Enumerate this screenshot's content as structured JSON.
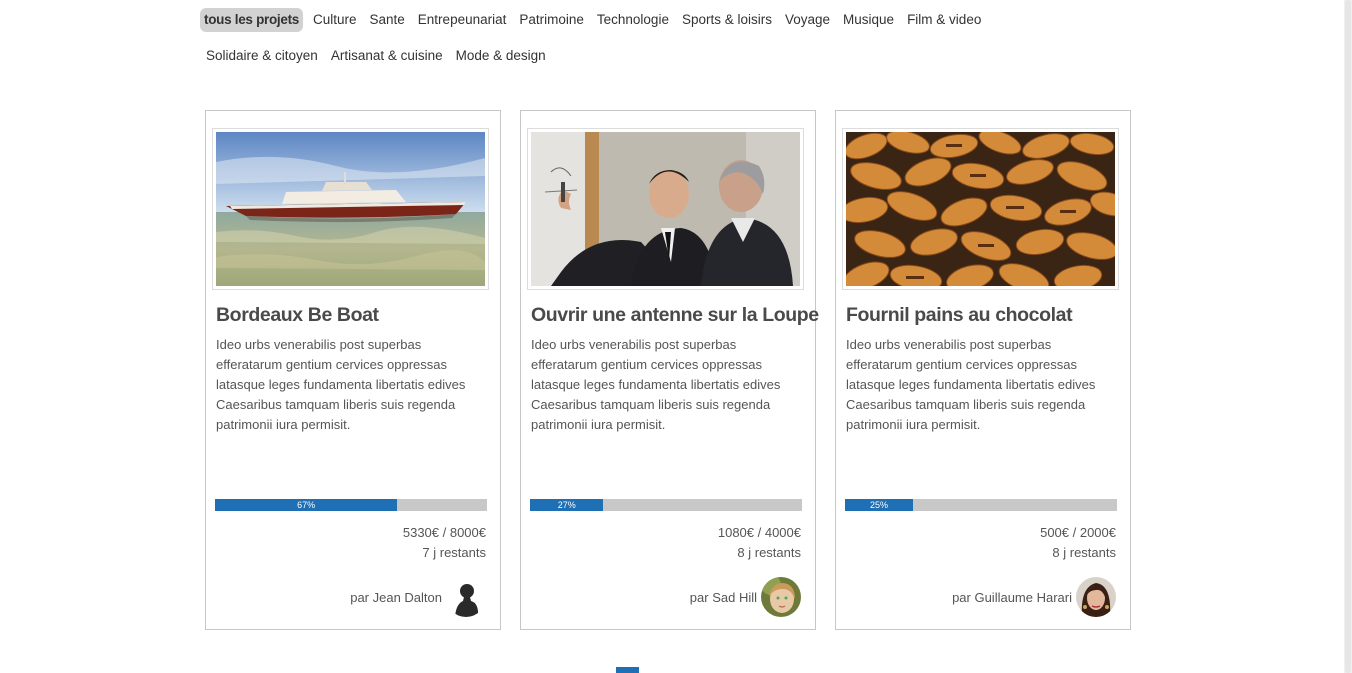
{
  "categories": [
    {
      "label": "tous les projets",
      "active": true
    },
    {
      "label": "Culture"
    },
    {
      "label": "Sante"
    },
    {
      "label": "Entrepeunariat"
    },
    {
      "label": "Patrimoine"
    },
    {
      "label": "Technologie"
    },
    {
      "label": "Sports & loisirs"
    },
    {
      "label": "Voyage"
    },
    {
      "label": "Musique"
    },
    {
      "label": "Film & video"
    },
    {
      "label": "Solidaire & citoyen"
    },
    {
      "label": "Artisanat & cuisine"
    },
    {
      "label": "Mode & design"
    }
  ],
  "projects": [
    {
      "image": "boat-photo",
      "title": "Bordeaux Be Boat",
      "description": "Ideo urbs venerabilis post superbas efferatarum gentium cervices oppressas latasque leges fundamenta libertatis edives Caesaribus tamquam liberis suis regenda patrimonii iura permisit.",
      "progress": 0.67,
      "progress_label": "67%",
      "amount": "5330€ / 8000€",
      "days_left": "7 j restants",
      "author": "par Jean Dalton",
      "avatar": "silhouette-avatar"
    },
    {
      "image": "meeting-photo",
      "title": "Ouvrir une antenne sur la Loupe",
      "description": "Ideo urbs venerabilis post superbas efferatarum gentium cervices oppressas latasque leges fundamenta libertatis edives Caesaribus tamquam liberis suis regenda patrimonii iura permisit.",
      "progress": 0.27,
      "progress_label": "27%",
      "amount": "1080€ / 4000€",
      "days_left": "8 j restants",
      "author": "par Sad Hill",
      "avatar": "child-avatar"
    },
    {
      "image": "pastries-photo",
      "title": "Fournil pains au chocolat",
      "description": "Ideo urbs venerabilis post superbas efferatarum gentium cervices oppressas latasque leges fundamenta libertatis edives Caesaribus tamquam liberis suis regenda patrimonii iura permisit.",
      "progress": 0.25,
      "progress_label": "25%",
      "amount": "500€ / 2000€",
      "days_left": "8 j restants",
      "author": "par Guillaume Harari",
      "avatar": "woman-avatar"
    }
  ],
  "colors": {
    "progress_fill": "#1e6fb3",
    "progress_track": "#c8c8c8",
    "active_tab": "#d2d2d2"
  }
}
